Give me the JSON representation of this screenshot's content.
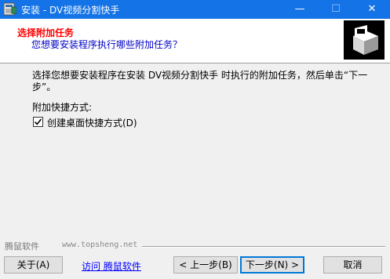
{
  "window": {
    "title": "安装 - DV视频分割快手",
    "minimize_glyph": "—",
    "maximize_glyph": "☐",
    "close_glyph": "✕",
    "icons": {
      "app": "installer-app-icon",
      "logo": "installer-box-logo-icon"
    }
  },
  "header": {
    "title": "选择附加任务",
    "subtitle": "您想要安装程序执行哪些附加任务？"
  },
  "body": {
    "description": "选择您想要安装程序在安装 DV视频分割快手 时执行的附加任务，然后单击“下一步”。",
    "group_label": "附加快捷方式:",
    "checkbox_label": "创建桌面快捷方式(D)",
    "checkbox_checked": true
  },
  "footer": {
    "brand": "腾鼠软件",
    "url": "www.topsheng.net",
    "about_button": "关于(A)",
    "visit_link": "访问 腾鼠软件",
    "back_button": "< 上一步(B)",
    "next_button": "下一步(N) >",
    "cancel_button": "取消"
  },
  "colors": {
    "titlebar": "#1473e6",
    "header_title": "#ff0000",
    "header_subtitle": "#0000c8",
    "link": "#0000ff",
    "default_button_border": "#0078d7"
  }
}
